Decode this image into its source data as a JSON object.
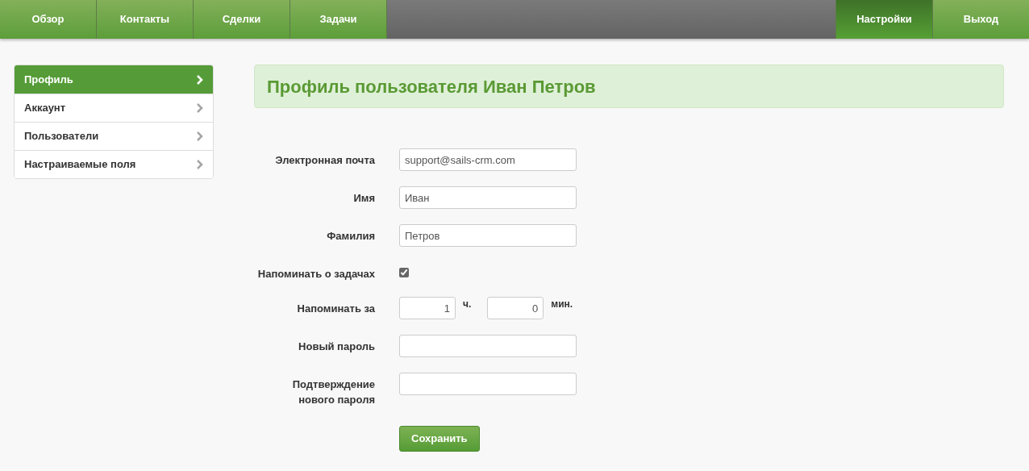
{
  "nav": {
    "left": [
      {
        "label": "Обзор",
        "selected": false
      },
      {
        "label": "Контакты",
        "selected": false
      },
      {
        "label": "Сделки",
        "selected": false
      },
      {
        "label": "Задачи",
        "selected": false
      }
    ],
    "right": [
      {
        "label": "Настройки",
        "selected": true
      },
      {
        "label": "Выход",
        "selected": false
      }
    ]
  },
  "sidebar": {
    "items": [
      {
        "label": "Профиль",
        "selected": true
      },
      {
        "label": "Аккаунт",
        "selected": false
      },
      {
        "label": "Пользователи",
        "selected": false
      },
      {
        "label": "Настраиваемые поля",
        "selected": false
      }
    ]
  },
  "page_title": "Профиль пользователя Иван Петров",
  "form": {
    "fields": [
      {
        "kind": "text",
        "label": "Электронная почта",
        "value": "support@sails-crm.com"
      },
      {
        "kind": "text",
        "label": "Имя",
        "value": "Иван"
      },
      {
        "kind": "text",
        "label": "Фамилия",
        "value": "Петров"
      },
      {
        "kind": "checkbox",
        "label": "Напоминать о задачах",
        "checked": true
      },
      {
        "kind": "duration",
        "label": "Напоминать за",
        "hours": "1",
        "hours_unit": "ч.",
        "minutes": "0",
        "minutes_unit": "мин."
      },
      {
        "kind": "password",
        "label": "Новый пароль"
      },
      {
        "kind": "password",
        "label": "Подтверждение нового пароля"
      }
    ],
    "submit": "Сохранить"
  }
}
